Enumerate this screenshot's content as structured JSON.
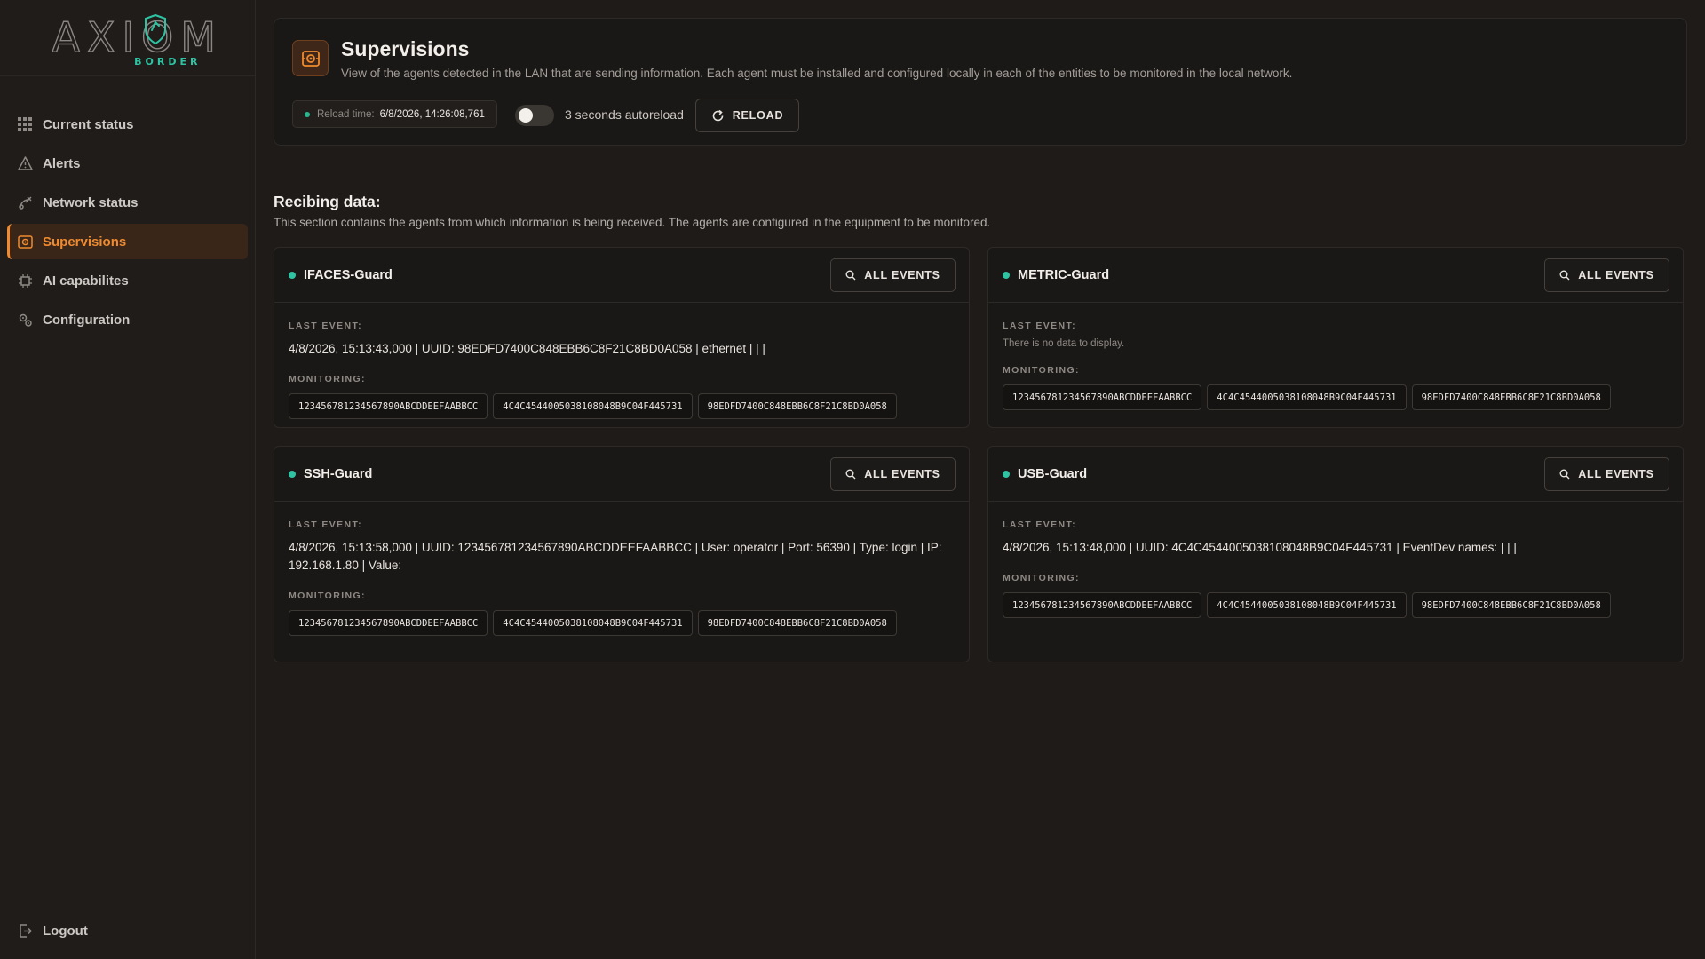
{
  "app": {
    "logo_text": "AXIOM",
    "logo_sub": "BORDER",
    "accent": "#ef8a2e",
    "status_color": "#2ec4a3"
  },
  "sidebar": {
    "items": [
      {
        "label": "Current status",
        "icon": "grid-icon"
      },
      {
        "label": "Alerts",
        "icon": "warning-icon"
      },
      {
        "label": "Network status",
        "icon": "satellite-icon"
      },
      {
        "label": "Supervisions",
        "icon": "supervision-icon",
        "active": true
      },
      {
        "label": "AI capabilites",
        "icon": "ai-chip-icon"
      },
      {
        "label": "Configuration",
        "icon": "gears-icon"
      }
    ],
    "logout": {
      "label": "Logout",
      "icon": "logout-icon"
    }
  },
  "header": {
    "title": "Supervisions",
    "description": "View of the agents detected in the LAN that are sending information. Each agent must be installed and configured locally in each of the entities to be monitored in the local network.",
    "reload_time_label": "Reload time:",
    "reload_time_value": "6/8/2026, 14:26:08,761",
    "autoreload_label": "3 seconds autoreload",
    "autoreload_enabled": false,
    "reload_button": "RELOAD"
  },
  "section": {
    "title": "Recibing data:",
    "description": "This section contains the agents from which information is being received. The agents are configured in the equipment to be monitored."
  },
  "labels": {
    "last_event": "LAST EVENT:",
    "monitoring": "MONITORING:",
    "all_events": "ALL EVENTS"
  },
  "agents": [
    {
      "name": "IFACES-Guard",
      "last_event": "4/8/2026, 15:13:43,000 | UUID: 98EDFD7400C848EBB6C8F21C8BD0A058 | ethernet | | |",
      "monitoring": [
        "123456781234567890ABCDDEEFAABBCC",
        "4C4C4544005038108048B9C04F445731",
        "98EDFD7400C848EBB6C8F21C8BD0A058"
      ]
    },
    {
      "name": "METRIC-Guard",
      "last_event": "",
      "no_data": "There is no data to display.",
      "monitoring": [
        "123456781234567890ABCDDEEFAABBCC",
        "4C4C4544005038108048B9C04F445731",
        "98EDFD7400C848EBB6C8F21C8BD0A058"
      ]
    },
    {
      "name": "SSH-Guard",
      "last_event": "4/8/2026, 15:13:58,000 | UUID: 123456781234567890ABCDDEEFAABBCC | User: operator | Port: 56390 | Type: login | IP: 192.168.1.80 | Value:",
      "monitoring": [
        "123456781234567890ABCDDEEFAABBCC",
        "4C4C4544005038108048B9C04F445731",
        "98EDFD7400C848EBB6C8F21C8BD0A058"
      ]
    },
    {
      "name": "USB-Guard",
      "last_event": "4/8/2026, 15:13:48,000 | UUID: 4C4C4544005038108048B9C04F445731 | EventDev names: | | |",
      "monitoring": [
        "123456781234567890ABCDDEEFAABBCC",
        "4C4C4544005038108048B9C04F445731",
        "98EDFD7400C848EBB6C8F21C8BD0A058"
      ]
    }
  ]
}
